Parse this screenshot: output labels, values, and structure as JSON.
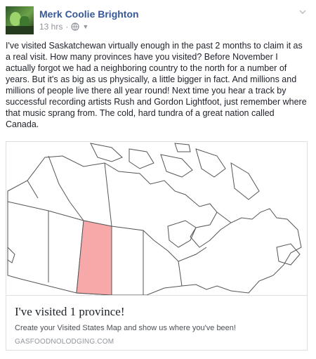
{
  "post": {
    "author": "Merk Coolie Brighton",
    "time": "13 hrs",
    "separator": "·",
    "text": "I've visited Saskatchewan virtually enough in the past 2 months to claim it as a real visit. How many provinces have you visited? Before November I actually forgot we had a neighboring country to the north for a number of years. But it's as big as us physically, a little bigger in fact. And millions and millions of people live there all year round! Next time you hear a track by successful recording artists Rush and Gordon Lightfoot, just remember where that music sprang from. The cold, hard tundra of a great nation called Canada."
  },
  "attachment": {
    "title": "I've visited 1 province!",
    "description": "Create your Visited States Map and show us where you've been!",
    "source": "GASFOODNOLODGING.COM"
  },
  "map": {
    "visited_province": "Saskatchewan",
    "visited_color": "#f7a8a8",
    "outline_color": "#555555"
  },
  "icons": {
    "privacy": "globe-icon",
    "audience": "caret-down-icon",
    "options": "chevron-down-icon"
  },
  "colors": {
    "link": "#365899",
    "meta": "#90949c",
    "text": "#1d2129"
  }
}
